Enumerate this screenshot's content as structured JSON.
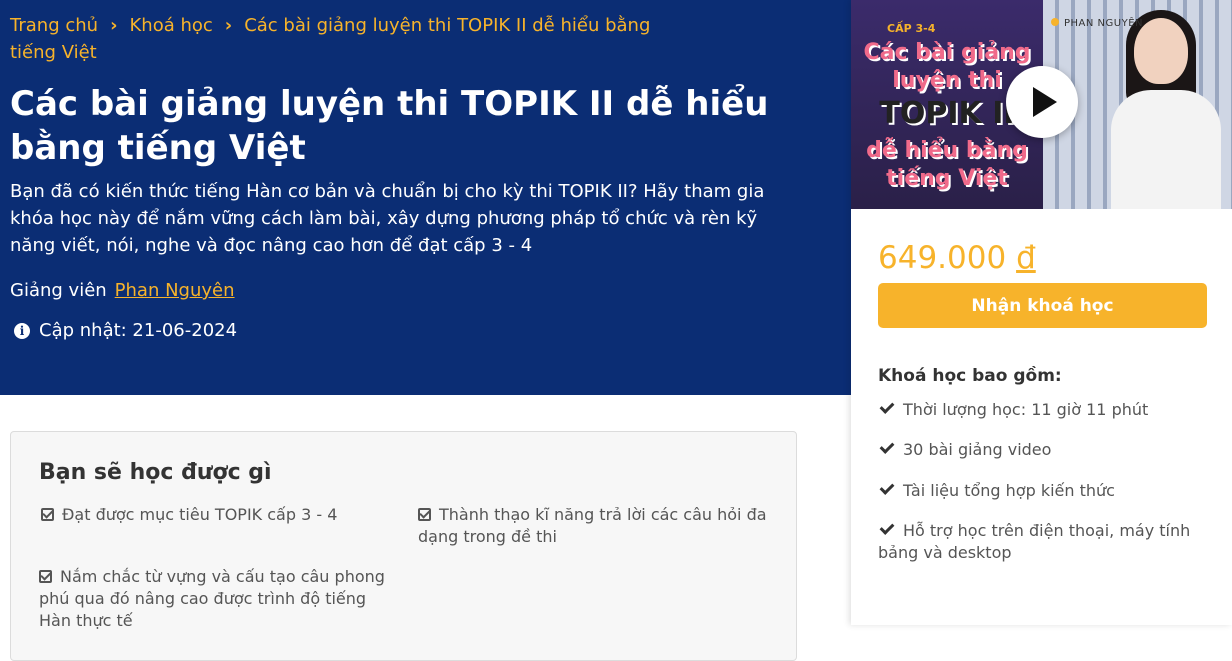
{
  "breadcrumb": {
    "home": "Trang chủ",
    "courses": "Khoá học",
    "current": "Các bài giảng luyện thi TOPIK II dễ hiểu bằng tiếng Việt",
    "separator": "›"
  },
  "course": {
    "title": "Các bài giảng luyện thi TOPIK II dễ hiểu bằng tiếng Việt",
    "description": "Bạn đã có kiến thức tiếng Hàn cơ bản và chuẩn bị cho kỳ thi TOPIK II? Hãy tham gia khóa học này để nắm vững cách làm bài, xây dựng phương pháp tổ chức và rèn kỹ năng viết, nói, nghe và đọc nâng cao hơn để đạt cấp 3 - 4",
    "instructor_label": "Giảng viên",
    "instructor_name": "Phan Nguyên",
    "updated": "Cập nhật: 21-06-2024"
  },
  "learn": {
    "title": "Bạn sẽ học được gì",
    "items": [
      "Đạt được mục tiêu TOPIK cấp 3 - 4",
      "Thành thạo kĩ năng trả lời các câu hỏi đa dạng trong đề thi",
      "Nắm chắc từ vựng và cấu tạo câu phong phú qua đó nâng cao được trình độ tiếng Hàn thực tế"
    ]
  },
  "thumbnail": {
    "level": "CẤP 3-4",
    "line1": "Các bài giảng",
    "line2": "luyện thi",
    "line3": "TOPIK II",
    "line4": "dễ hiểu bằng",
    "line5": "tiếng Việt",
    "author": "PHAN NGUYÊN"
  },
  "sidebar": {
    "price": "649.000",
    "currency": "đ",
    "enroll_label": "Nhận khoá học",
    "includes_title": "Khoá học bao gồm:",
    "includes": [
      "Thời lượng học: 11 giờ 11 phút",
      "30 bài giảng video",
      "Tài liệu tổng hợp kiến thức",
      "Hỗ trợ học trên điện thoại, máy tính bảng và desktop"
    ]
  },
  "colors": {
    "hero_bg": "#0b2d74",
    "accent": "#f7b32b"
  }
}
